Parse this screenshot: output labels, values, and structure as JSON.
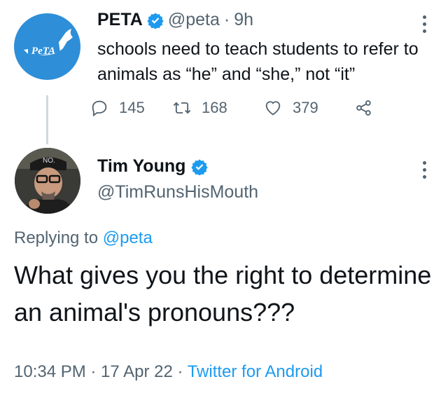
{
  "original_tweet": {
    "author_name": "PETA",
    "handle": "@peta",
    "separator": "·",
    "time": "9h",
    "text": "schools need to teach students to refer to animals as “he” and “she,” not “it”",
    "avatar_text": "PeTA",
    "stats": {
      "replies": "145",
      "retweets": "168",
      "likes": "379"
    }
  },
  "reply_tweet": {
    "author_name": "Tim Young",
    "handle": "@TimRunsHisMouth",
    "replying_prefix": "Replying to",
    "replying_to": "@peta",
    "text": "What gives you the right to determine an animal's pronouns???",
    "timestamp": "10:34 PM · 17 Apr 22 · ",
    "source": "Twitter for Android",
    "avatar_cap_text": "NO."
  },
  "colors": {
    "brand_blue": "#1d9bf0",
    "peta_blue": "#2e8ed8",
    "muted": "#536471",
    "text": "#0f1419"
  },
  "icons": [
    "reply-icon",
    "retweet-icon",
    "like-icon",
    "share-icon",
    "verified-badge-icon",
    "more-options-icon"
  ]
}
